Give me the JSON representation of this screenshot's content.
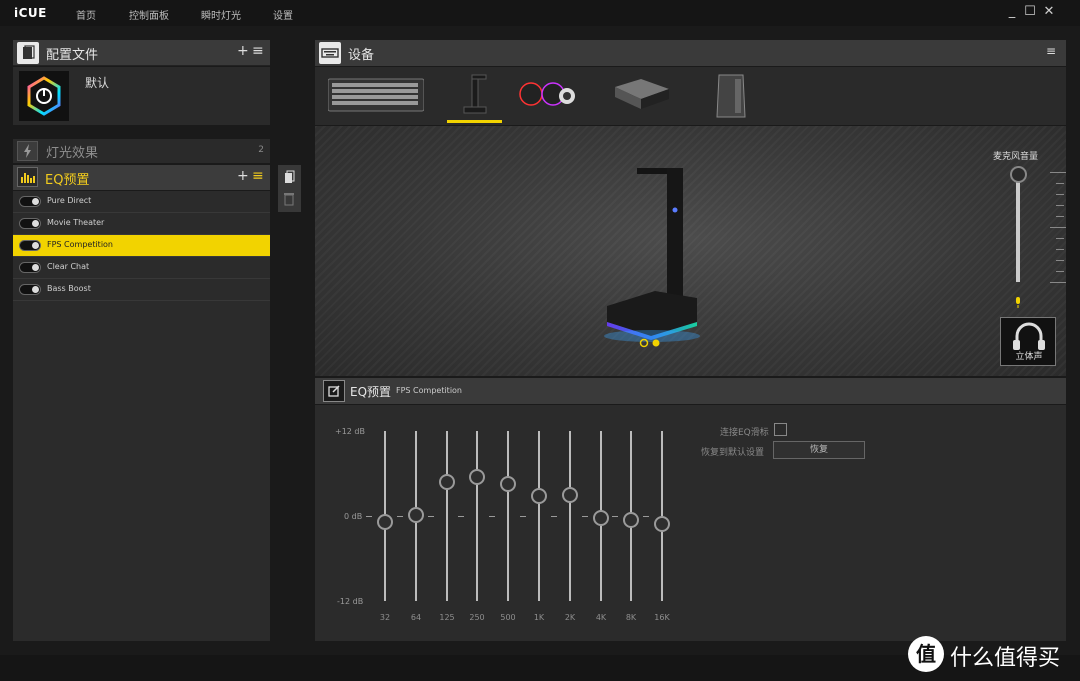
{
  "app": {
    "name": "iCUE"
  },
  "nav": [
    "首页",
    "控制面板",
    "瞬时灯光",
    "设置"
  ],
  "window": {
    "minimize": "_",
    "maximize": "☐",
    "close": "✕"
  },
  "profiles": {
    "title": "配置文件",
    "add": "+",
    "menu": "≡",
    "items": [
      {
        "name": "默认"
      }
    ]
  },
  "lighting": {
    "title": "灯光效果",
    "count": "2"
  },
  "eq_presets": {
    "title": "EQ预置",
    "add": "+",
    "menu": "≡",
    "items": [
      {
        "label": "Pure Direct",
        "active": false
      },
      {
        "label": "Movie Theater",
        "active": false
      },
      {
        "label": "FPS Competition",
        "active": true
      },
      {
        "label": "Clear Chat",
        "active": false
      },
      {
        "label": "Bass Boost",
        "active": false
      }
    ]
  },
  "devices": {
    "title": "设备",
    "menu": "≡",
    "selected_index": 1
  },
  "mic": {
    "label": "麦克风音量",
    "level": 0.95
  },
  "stereo": {
    "label": "立体声"
  },
  "eq_panel": {
    "title": "EQ预置",
    "preset_name": "FPS Competition",
    "db_top": "+12 dB",
    "db_mid": "0 dB",
    "db_bottom": "-12 dB",
    "bands": [
      {
        "freq": "32",
        "db": -0.8
      },
      {
        "freq": "64",
        "db": 0.2
      },
      {
        "freq": "125",
        "db": 4.8
      },
      {
        "freq": "250",
        "db": 5.5
      },
      {
        "freq": "500",
        "db": 4.5
      },
      {
        "freq": "1K",
        "db": 2.8
      },
      {
        "freq": "2K",
        "db": 3.0
      },
      {
        "freq": "4K",
        "db": -0.3
      },
      {
        "freq": "8K",
        "db": -0.6
      },
      {
        "freq": "16K",
        "db": -1.1
      }
    ],
    "link_label": "连接EQ滑标",
    "reset_label": "恢复到默认设置",
    "reset_button": "恢复"
  },
  "watermark": {
    "text": "什么值得买"
  },
  "colors": {
    "accent": "#f2d300",
    "panel": "#2b2b2b",
    "header": "#3a3a3a"
  }
}
